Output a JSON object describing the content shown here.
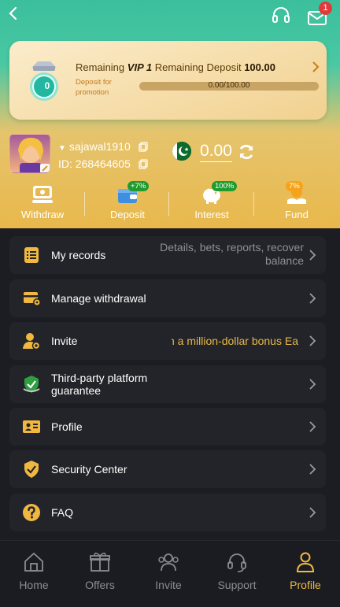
{
  "header": {
    "notification_count": "1"
  },
  "vip": {
    "label_remaining": "Remaining",
    "level": "VIP 1",
    "label_remaining_deposit": "Remaining Deposit",
    "remaining_deposit": "100.00",
    "level_badge": "0",
    "note": "Deposit for promotion",
    "progress_text": "0.00/100.00",
    "progress_fraction": 0
  },
  "user": {
    "username": "sajawal1910",
    "id_text": "ID: 268464605",
    "balance": "0.00"
  },
  "quick_actions": [
    {
      "label": "Withdraw",
      "tag": ""
    },
    {
      "label": "Deposit",
      "tag": "+7%"
    },
    {
      "label": "Interest",
      "tag": "100%"
    },
    {
      "label": "Fund",
      "tag": "7%"
    }
  ],
  "menu": {
    "records": {
      "label": "My records",
      "sub": "Details, bets, reports, recover balance"
    },
    "withdrawal": {
      "label": "Manage withdrawal"
    },
    "invite": {
      "label": "Invite",
      "marquee": "n a million-dollar bonus Ea"
    },
    "third_party": {
      "label": "Third-party platform guarantee"
    },
    "profile": {
      "label": "Profile"
    },
    "security": {
      "label": "Security Center"
    },
    "faq": {
      "label": "FAQ"
    }
  },
  "nav": {
    "home": "Home",
    "offers": "Offers",
    "invite": "Invite",
    "support": "Support",
    "profile": "Profile"
  },
  "colors": {
    "accent": "#f0b840",
    "teal": "#3bbf9c",
    "gold": "#e8b84c",
    "menu_bg": "#232429"
  }
}
